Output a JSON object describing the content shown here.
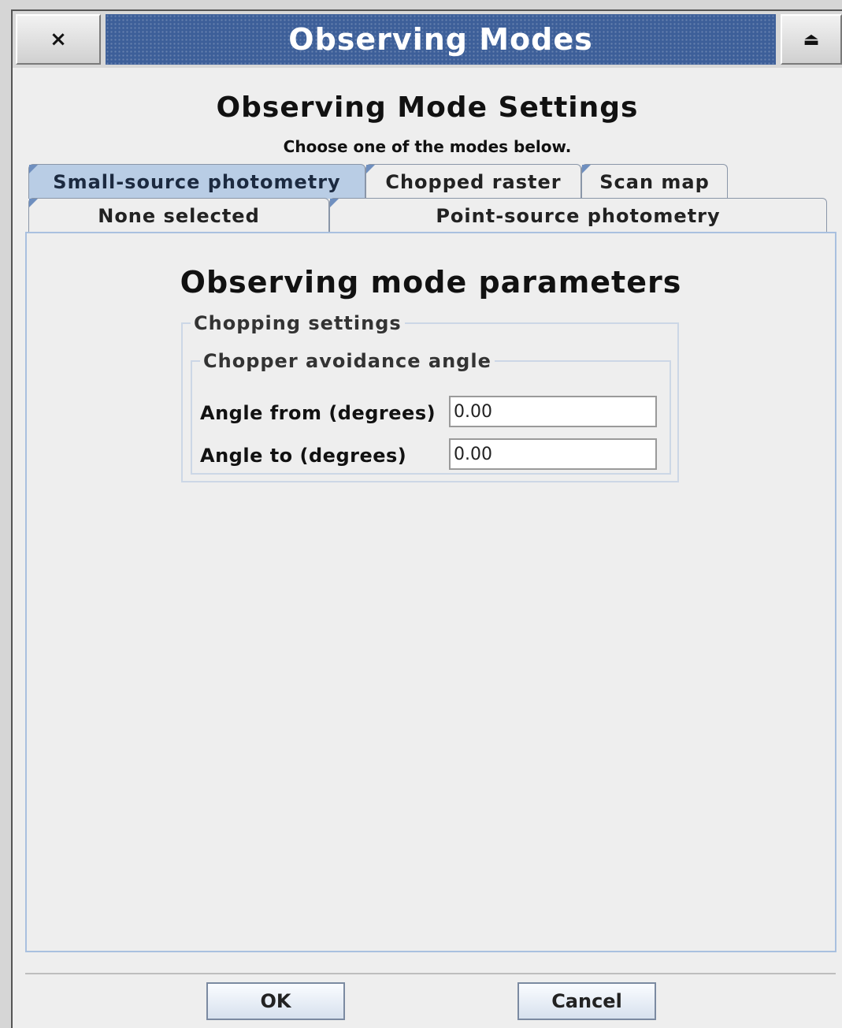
{
  "window": {
    "title": "Observing Modes",
    "close_glyph": "×",
    "shade_glyph": "⏏",
    "close_icon": "close-icon",
    "shade_icon": "eject-icon"
  },
  "header": {
    "title": "Observing Mode Settings",
    "subtitle": "Choose one of the modes below."
  },
  "tabs": {
    "row1": [
      {
        "label": "Small-source photometry",
        "selected": true
      },
      {
        "label": "Chopped raster",
        "selected": false
      },
      {
        "label": "Scan map",
        "selected": false
      }
    ],
    "row2": [
      {
        "label": "None selected",
        "selected": false
      },
      {
        "label": "Point-source photometry",
        "selected": false
      }
    ]
  },
  "panel": {
    "title": "Observing mode parameters",
    "chopping": {
      "legend": "Chopping settings",
      "avoidance": {
        "legend": "Chopper avoidance angle",
        "angle_from_label": "Angle from (degrees)",
        "angle_from_value": "0.00",
        "angle_to_label": "Angle to (degrees)",
        "angle_to_value": "0.00"
      }
    }
  },
  "buttons": {
    "ok": "OK",
    "cancel": "Cancel"
  },
  "colors": {
    "title_bar": "#3d5f99",
    "selected_tab": "#b9cde5",
    "panel_border": "#a9c0df"
  }
}
